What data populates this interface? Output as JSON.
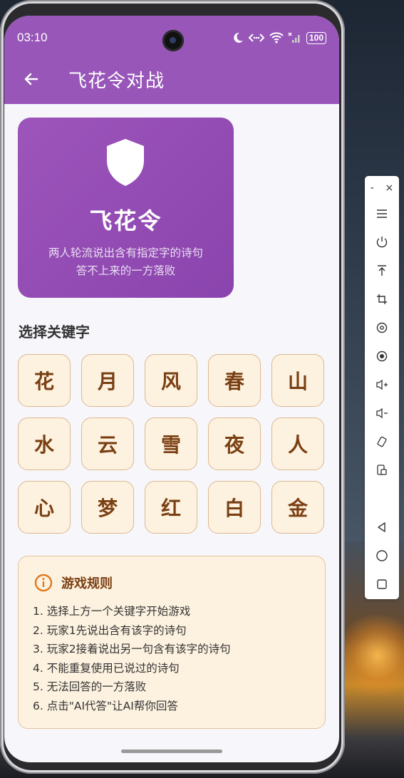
{
  "status_bar": {
    "time": "03:10",
    "battery": "100"
  },
  "app_bar": {
    "title": "飞花令对战"
  },
  "hero": {
    "title": "飞花令",
    "desc_line1": "两人轮流说出含有指定字的诗句",
    "desc_line2": "答不上来的一方落败"
  },
  "keyword_section": {
    "title": "选择关键字",
    "keys": [
      "花",
      "月",
      "风",
      "春",
      "山",
      "水",
      "云",
      "雪",
      "夜",
      "人",
      "心",
      "梦",
      "红",
      "白",
      "金"
    ]
  },
  "rules": {
    "title": "游戏规则",
    "items": [
      "1. 选择上方一个关键字开始游戏",
      "2. 玩家1先说出含有该字的诗句",
      "3. 玩家2接着说出另一句含有该字的诗句",
      "4. 不能重复使用已说过的诗句",
      "5. 无法回答的一方落败",
      "6. 点击\"AI代答\"让AI帮你回答"
    ]
  },
  "emulator_toolbar": {
    "minimize": "-",
    "close": "×"
  },
  "colors": {
    "app_bar": "#9756b8",
    "hero": "#8f4cb3",
    "key_bg": "#fdf2e0",
    "key_text": "#7a3f12",
    "key_border": "#dcb98f",
    "screen_bg": "#f6f6fb"
  }
}
